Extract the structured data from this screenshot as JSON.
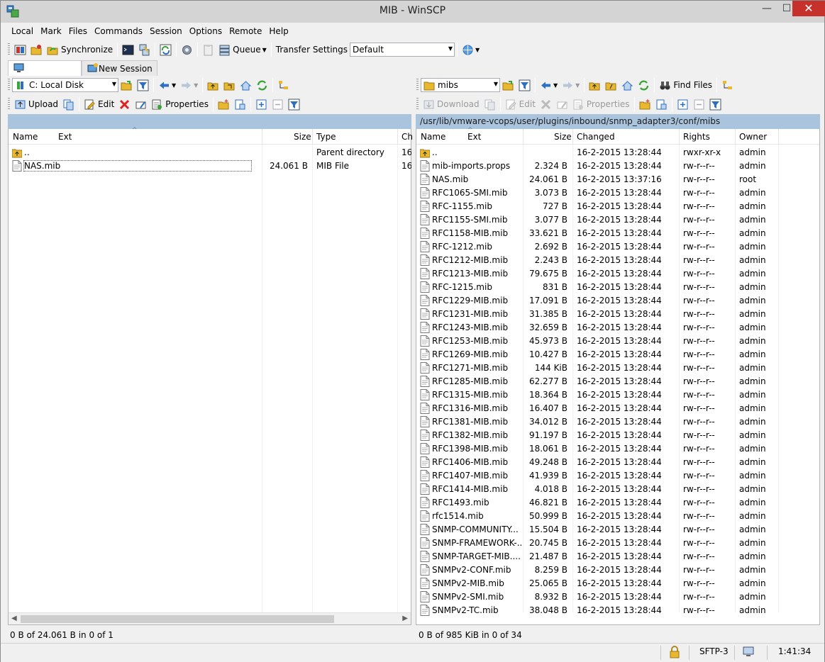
{
  "window": {
    "title": "MIB - WinSCP",
    "minimize": "—",
    "maximize": "☐",
    "close": "✕"
  },
  "menu": [
    "Local",
    "Mark",
    "Files",
    "Commands",
    "Session",
    "Options",
    "Remote",
    "Help"
  ],
  "toolbar": {
    "synchronize": "Synchronize",
    "queue": "Queue",
    "transfer_settings_label": "Transfer Settings",
    "transfer_settings_value": "Default"
  },
  "tabs": {
    "active": "",
    "new_session": "New Session"
  },
  "local": {
    "drive": "C: Local Disk",
    "upload": "Upload",
    "edit": "Edit",
    "properties": "Properties",
    "path": "",
    "columns": [
      "Name",
      "Ext",
      "Size",
      "Type",
      "Ch"
    ],
    "files": [
      {
        "name": "..",
        "size": "",
        "type": "Parent directory",
        "ch": "16",
        "icon": "folder-up"
      },
      {
        "name": "NAS.mib",
        "size": "24.061 B",
        "type": "MIB File",
        "ch": "16",
        "icon": "file"
      }
    ],
    "status": "0 B of 24.061 B in 0 of 1"
  },
  "remote": {
    "folder": "mibs",
    "find_files": "Find Files",
    "download": "Download",
    "edit": "Edit",
    "properties": "Properties",
    "path": "/usr/lib/vmware-vcops/user/plugins/inbound/snmp_adapter3/conf/mibs",
    "columns": [
      "Name",
      "Ext",
      "Size",
      "Changed",
      "Rights",
      "Owner"
    ],
    "files": [
      {
        "name": "..",
        "size": "",
        "changed": "16-2-2015 13:28:44",
        "rights": "rwxr-xr-x",
        "owner": "admin",
        "icon": "folder-up"
      },
      {
        "name": "mib-imports.props",
        "size": "2.324 B",
        "changed": "16-2-2015 13:28:44",
        "rights": "rw-r--r--",
        "owner": "admin",
        "icon": "file"
      },
      {
        "name": "NAS.mib",
        "size": "24.061 B",
        "changed": "16-2-2015 13:37:16",
        "rights": "rw-r--r--",
        "owner": "root",
        "icon": "file"
      },
      {
        "name": "RFC1065-SMI.mib",
        "size": "3.073 B",
        "changed": "16-2-2015 13:28:44",
        "rights": "rw-r--r--",
        "owner": "admin",
        "icon": "file"
      },
      {
        "name": "RFC-1155.mib",
        "size": "727 B",
        "changed": "16-2-2015 13:28:44",
        "rights": "rw-r--r--",
        "owner": "admin",
        "icon": "file"
      },
      {
        "name": "RFC1155-SMI.mib",
        "size": "3.077 B",
        "changed": "16-2-2015 13:28:44",
        "rights": "rw-r--r--",
        "owner": "admin",
        "icon": "file"
      },
      {
        "name": "RFC1158-MIB.mib",
        "size": "33.621 B",
        "changed": "16-2-2015 13:28:44",
        "rights": "rw-r--r--",
        "owner": "admin",
        "icon": "file"
      },
      {
        "name": "RFC-1212.mib",
        "size": "2.692 B",
        "changed": "16-2-2015 13:28:44",
        "rights": "rw-r--r--",
        "owner": "admin",
        "icon": "file"
      },
      {
        "name": "RFC1212-MIB.mib",
        "size": "2.243 B",
        "changed": "16-2-2015 13:28:44",
        "rights": "rw-r--r--",
        "owner": "admin",
        "icon": "file"
      },
      {
        "name": "RFC1213-MIB.mib",
        "size": "79.675 B",
        "changed": "16-2-2015 13:28:44",
        "rights": "rw-r--r--",
        "owner": "admin",
        "icon": "file"
      },
      {
        "name": "RFC-1215.mib",
        "size": "831 B",
        "changed": "16-2-2015 13:28:44",
        "rights": "rw-r--r--",
        "owner": "admin",
        "icon": "file"
      },
      {
        "name": "RFC1229-MIB.mib",
        "size": "17.091 B",
        "changed": "16-2-2015 13:28:44",
        "rights": "rw-r--r--",
        "owner": "admin",
        "icon": "file"
      },
      {
        "name": "RFC1231-MIB.mib",
        "size": "31.385 B",
        "changed": "16-2-2015 13:28:44",
        "rights": "rw-r--r--",
        "owner": "admin",
        "icon": "file"
      },
      {
        "name": "RFC1243-MIB.mib",
        "size": "32.659 B",
        "changed": "16-2-2015 13:28:44",
        "rights": "rw-r--r--",
        "owner": "admin",
        "icon": "file"
      },
      {
        "name": "RFC1253-MIB.mib",
        "size": "45.973 B",
        "changed": "16-2-2015 13:28:44",
        "rights": "rw-r--r--",
        "owner": "admin",
        "icon": "file"
      },
      {
        "name": "RFC1269-MIB.mib",
        "size": "10.427 B",
        "changed": "16-2-2015 13:28:44",
        "rights": "rw-r--r--",
        "owner": "admin",
        "icon": "file"
      },
      {
        "name": "RFC1271-MIB.mib",
        "size": "144 KiB",
        "changed": "16-2-2015 13:28:44",
        "rights": "rw-r--r--",
        "owner": "admin",
        "icon": "file"
      },
      {
        "name": "RFC1285-MIB.mib",
        "size": "62.277 B",
        "changed": "16-2-2015 13:28:44",
        "rights": "rw-r--r--",
        "owner": "admin",
        "icon": "file"
      },
      {
        "name": "RFC1315-MIB.mib",
        "size": "18.364 B",
        "changed": "16-2-2015 13:28:44",
        "rights": "rw-r--r--",
        "owner": "admin",
        "icon": "file"
      },
      {
        "name": "RFC1316-MIB.mib",
        "size": "16.407 B",
        "changed": "16-2-2015 13:28:44",
        "rights": "rw-r--r--",
        "owner": "admin",
        "icon": "file"
      },
      {
        "name": "RFC1381-MIB.mib",
        "size": "34.012 B",
        "changed": "16-2-2015 13:28:44",
        "rights": "rw-r--r--",
        "owner": "admin",
        "icon": "file"
      },
      {
        "name": "RFC1382-MIB.mib",
        "size": "91.197 B",
        "changed": "16-2-2015 13:28:44",
        "rights": "rw-r--r--",
        "owner": "admin",
        "icon": "file"
      },
      {
        "name": "RFC1398-MIB.mib",
        "size": "18.061 B",
        "changed": "16-2-2015 13:28:44",
        "rights": "rw-r--r--",
        "owner": "admin",
        "icon": "file"
      },
      {
        "name": "RFC1406-MIB.mib",
        "size": "49.248 B",
        "changed": "16-2-2015 13:28:44",
        "rights": "rw-r--r--",
        "owner": "admin",
        "icon": "file"
      },
      {
        "name": "RFC1407-MIB.mib",
        "size": "41.939 B",
        "changed": "16-2-2015 13:28:44",
        "rights": "rw-r--r--",
        "owner": "admin",
        "icon": "file"
      },
      {
        "name": "RFC1414-MIB.mib",
        "size": "4.018 B",
        "changed": "16-2-2015 13:28:44",
        "rights": "rw-r--r--",
        "owner": "admin",
        "icon": "file"
      },
      {
        "name": "RFC1493.mib",
        "size": "46.821 B",
        "changed": "16-2-2015 13:28:44",
        "rights": "rw-r--r--",
        "owner": "admin",
        "icon": "file"
      },
      {
        "name": "rfc1514.mib",
        "size": "50.999 B",
        "changed": "16-2-2015 13:28:44",
        "rights": "rw-r--r--",
        "owner": "admin",
        "icon": "file"
      },
      {
        "name": "SNMP-COMMUNITY...",
        "size": "15.504 B",
        "changed": "16-2-2015 13:28:44",
        "rights": "rw-r--r--",
        "owner": "admin",
        "icon": "file"
      },
      {
        "name": "SNMP-FRAMEWORK-...",
        "size": "20.745 B",
        "changed": "16-2-2015 13:28:44",
        "rights": "rw-r--r--",
        "owner": "admin",
        "icon": "file"
      },
      {
        "name": "SNMP-TARGET-MIB....",
        "size": "21.487 B",
        "changed": "16-2-2015 13:28:44",
        "rights": "rw-r--r--",
        "owner": "admin",
        "icon": "file"
      },
      {
        "name": "SNMPv2-CONF.mib",
        "size": "8.259 B",
        "changed": "16-2-2015 13:28:44",
        "rights": "rw-r--r--",
        "owner": "admin",
        "icon": "file"
      },
      {
        "name": "SNMPv2-MIB.mib",
        "size": "25.065 B",
        "changed": "16-2-2015 13:28:44",
        "rights": "rw-r--r--",
        "owner": "admin",
        "icon": "file"
      },
      {
        "name": "SNMPv2-SMI.mib",
        "size": "8.932 B",
        "changed": "16-2-2015 13:28:44",
        "rights": "rw-r--r--",
        "owner": "admin",
        "icon": "file"
      },
      {
        "name": "SNMPv2-TC.mib",
        "size": "38.048 B",
        "changed": "16-2-2015 13:28:44",
        "rights": "rw-r--r--",
        "owner": "admin",
        "icon": "file"
      }
    ],
    "status": "0 B of 985 KiB in 0 of 34"
  },
  "statusbar": {
    "protocol": "SFTP-3",
    "time": "1:41:34"
  },
  "colors": {
    "path_bar": "#aac4de",
    "folder": "#e8b830",
    "arrow_blue": "#2d6fc1",
    "green": "#3aa537",
    "close_red": "#c7312b"
  }
}
